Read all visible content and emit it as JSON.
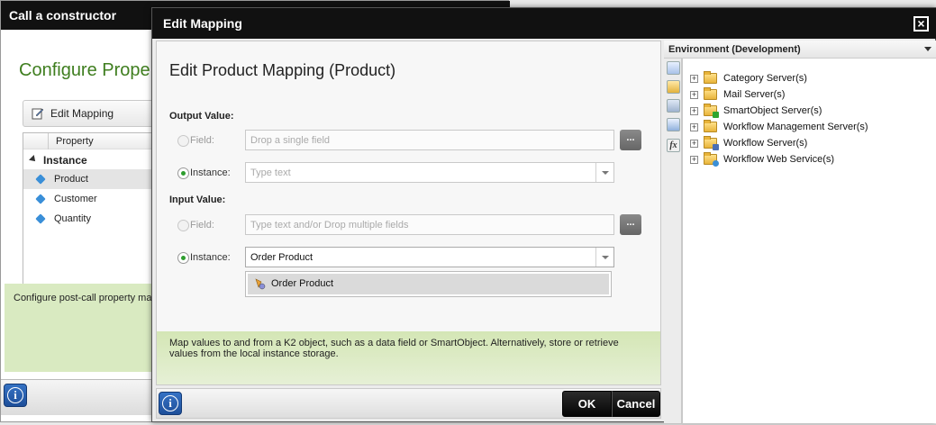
{
  "background_window": {
    "title": "Call a constructor",
    "heading": "Configure Prope",
    "edit_mapping_label": "Edit Mapping",
    "grid": {
      "column_header": "Property",
      "group": "Instance",
      "rows": [
        "Product",
        "Customer",
        "Quantity"
      ]
    },
    "description": "Configure post-call property ma",
    "info_button": "i"
  },
  "dialog": {
    "title": "Edit Mapping",
    "close_glyph": "×",
    "heading": "Edit Product Mapping (Product)",
    "output": {
      "section_label": "Output Value:",
      "field_label": "Field:",
      "field_placeholder": "Drop a single field",
      "browse_label": "...",
      "instance_label": "Instance:",
      "instance_placeholder": "Type text",
      "selected": "instance"
    },
    "input": {
      "section_label": "Input Value:",
      "field_label": "Field:",
      "field_placeholder": "Type text and/or Drop multiple fields",
      "browse_label": "...",
      "instance_label": "Instance:",
      "instance_value": "Order Product",
      "selected": "instance",
      "dropdown_options": [
        "Order Product"
      ]
    },
    "help_text": "Map values to and from a K2 object, such as a data field or SmartObject. Alternatively, store or retrieve values from the local instance storage.",
    "ok_label": "OK",
    "cancel_label": "Cancel",
    "info_button": "i"
  },
  "environment": {
    "title": "Environment (Development)",
    "side_tabs": [
      "environment-icon",
      "category-icon",
      "smartobject-icon",
      "server-icon",
      "function-icon"
    ],
    "function_tab_label": "fx",
    "tree": [
      {
        "label": "Category Server(s)",
        "badge_color": "#d9a21c"
      },
      {
        "label": "Mail Server(s)",
        "badge_color": "#d9a21c"
      },
      {
        "label": "SmartObject Server(s)",
        "badge_color": "#2fa52f"
      },
      {
        "label": "Workflow Management Server(s)",
        "badge_color": "#d9a21c"
      },
      {
        "label": "Workflow Server(s)",
        "badge_color": "#4a6fb5"
      },
      {
        "label": "Workflow Web Service(s)",
        "badge_color": "#3b8fd6"
      }
    ]
  },
  "colors": {
    "accent_green": "#3f7e1f",
    "radio_selected": "#2e9d2e",
    "help_background": "#d4e6b5"
  }
}
